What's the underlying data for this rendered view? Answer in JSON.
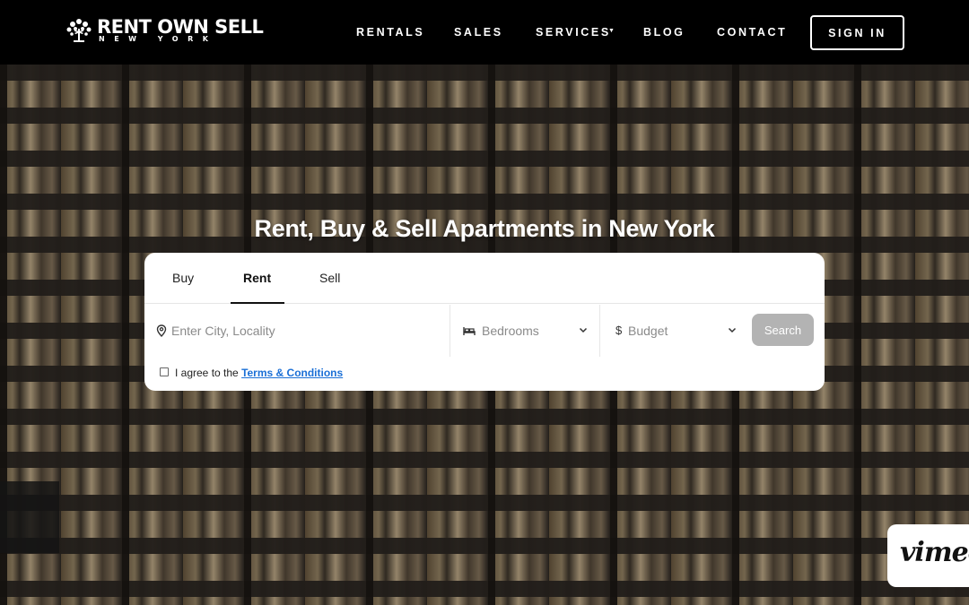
{
  "brand": {
    "name": "RENT OWN SELL",
    "subtitle": "NEW YORK"
  },
  "nav": {
    "items": [
      {
        "label": "RENTALS"
      },
      {
        "label": "SALES"
      },
      {
        "label": "SERVICES"
      },
      {
        "label": "BLOG"
      },
      {
        "label": "CONTACT"
      }
    ],
    "signin": "SIGN IN"
  },
  "hero": {
    "title": "Rent, Buy & Sell Apartments in New York"
  },
  "search": {
    "tabs": [
      {
        "label": "Buy"
      },
      {
        "label": "Rent",
        "active": true
      },
      {
        "label": "Sell"
      }
    ],
    "location_placeholder": "Enter City, Locality",
    "bedrooms_label": "Bedrooms",
    "budget_label": "Budget",
    "currency_symbol": "$",
    "search_button": "Search",
    "agree_text": "I agree to the ",
    "terms_link": "Terms & Conditions"
  },
  "video": {
    "badge_text": "vimeo"
  },
  "colors": {
    "nav_bg": "#000000",
    "link": "#1a6fd6",
    "search_button": "#b3b3b3"
  },
  "icons": [
    "tree-logo-icon",
    "caret-down-icon",
    "map-pin-icon",
    "bed-icon",
    "chevron-down-icon",
    "dollar-icon"
  ]
}
